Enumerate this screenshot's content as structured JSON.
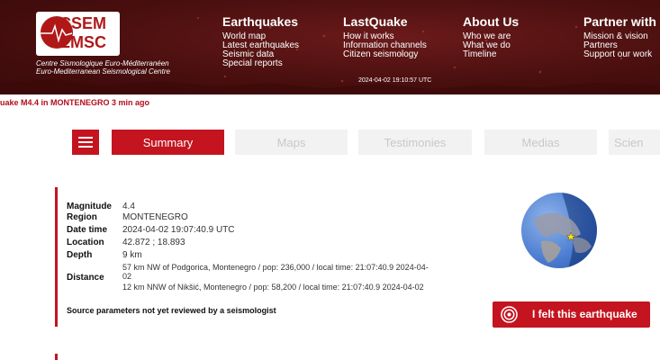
{
  "header": {
    "logo": {
      "line1": "CSEM",
      "line2": "EMSC",
      "sub1": "Centre Sismologique Euro-Méditerranéen",
      "sub2": "Euro-Mediterranean Seismological Centre"
    },
    "nav": [
      {
        "heading": "Earthquakes",
        "items": [
          "World map",
          "Latest earthquakes",
          "Seismic data",
          "Special reports"
        ]
      },
      {
        "heading": "LastQuake",
        "items": [
          "How it works",
          "Information channels",
          "Citizen seismology"
        ]
      },
      {
        "heading": "About Us",
        "items": [
          "Who we are",
          "What we do",
          "Timeline"
        ]
      },
      {
        "heading": "Partner with u",
        "items": [
          "Mission & vision",
          "Partners",
          "Support our work"
        ]
      }
    ],
    "datetime": "2024-04-02 19:10:57 UTC"
  },
  "alert": "uake M4.4 in MONTENEGRO 3 min ago",
  "tabs": [
    "Summary",
    "Maps",
    "Testimonies",
    "Medias",
    "Scien"
  ],
  "details": {
    "magnitude": {
      "label": "Magnitude",
      "value": "4.4"
    },
    "region": {
      "label": "Region",
      "value": "MONTENEGRO"
    },
    "datetime": {
      "label": "Date time",
      "value": "2024-04-02 19:07:40.9 UTC"
    },
    "location": {
      "label": "Location",
      "value": "42.872 ; 18.893"
    },
    "depth": {
      "label": "Depth",
      "value": "9 km"
    },
    "distance": {
      "label": "Distance",
      "line1": "57 km NW of Podgorica, Montenegro / pop: 236,000 / local time: 21:07:40.9 2024-04-",
      "line2": "02",
      "line3": "12 km NNW of Nikšić, Montenegro / pop: 58,200 / local time: 21:07:40.9 2024-04-02"
    },
    "review_note": "Source parameters not yet reviewed by a seismologist"
  },
  "felt_button": "I felt this earthquake",
  "colors": {
    "brand_red": "#c41420",
    "header_bg": "#4a0f0f",
    "tab_inactive_bg": "#f2f2f2"
  }
}
